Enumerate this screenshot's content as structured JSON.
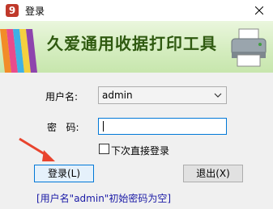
{
  "window": {
    "title": "登录",
    "app_icon_glyph": "9"
  },
  "banner": {
    "title": "久爱通用收据打印工具"
  },
  "form": {
    "username_label": "用户名:",
    "username_value": "admin",
    "password_label": "密   码:",
    "password_value": "",
    "remember_label": "下次直接登录",
    "remember_checked": false
  },
  "buttons": {
    "login_label": "登录(L)",
    "exit_label": "退出(X)"
  },
  "hint": "[用户名\"admin\"初始密码为空]",
  "colors": {
    "banner_title": "#2f5a10",
    "hint": "#1a1aa6",
    "focus_border": "#0078d7",
    "arrow": "#e8442e"
  }
}
